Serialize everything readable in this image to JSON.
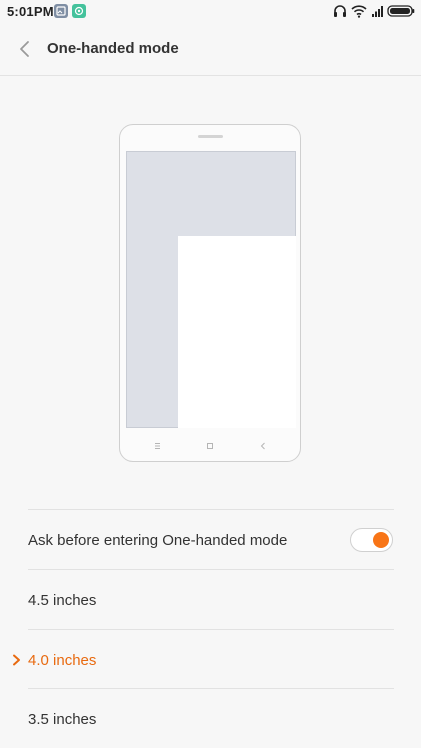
{
  "status_bar": {
    "time": "5:01PM",
    "icons": [
      "gallery-app-icon",
      "wechat-app-icon",
      "headphones-icon",
      "wifi-icon",
      "signal-icon",
      "battery-icon"
    ]
  },
  "header": {
    "title": "One-handed mode",
    "back_icon": "chevron-left-icon"
  },
  "illustration": {
    "description_icons": [
      "menu-key-icon",
      "home-key-icon",
      "back-key-icon"
    ]
  },
  "settings": {
    "ask_before": {
      "label": "Ask before entering One-handed mode",
      "enabled": true
    },
    "sizes": [
      {
        "label": "4.5 inches",
        "selected": false
      },
      {
        "label": "4.0 inches",
        "selected": true
      },
      {
        "label": "3.5 inches",
        "selected": false
      }
    ]
  },
  "colors": {
    "accent": "#f87517",
    "selected_text": "#e86a10",
    "background": "#f7f7f7"
  }
}
